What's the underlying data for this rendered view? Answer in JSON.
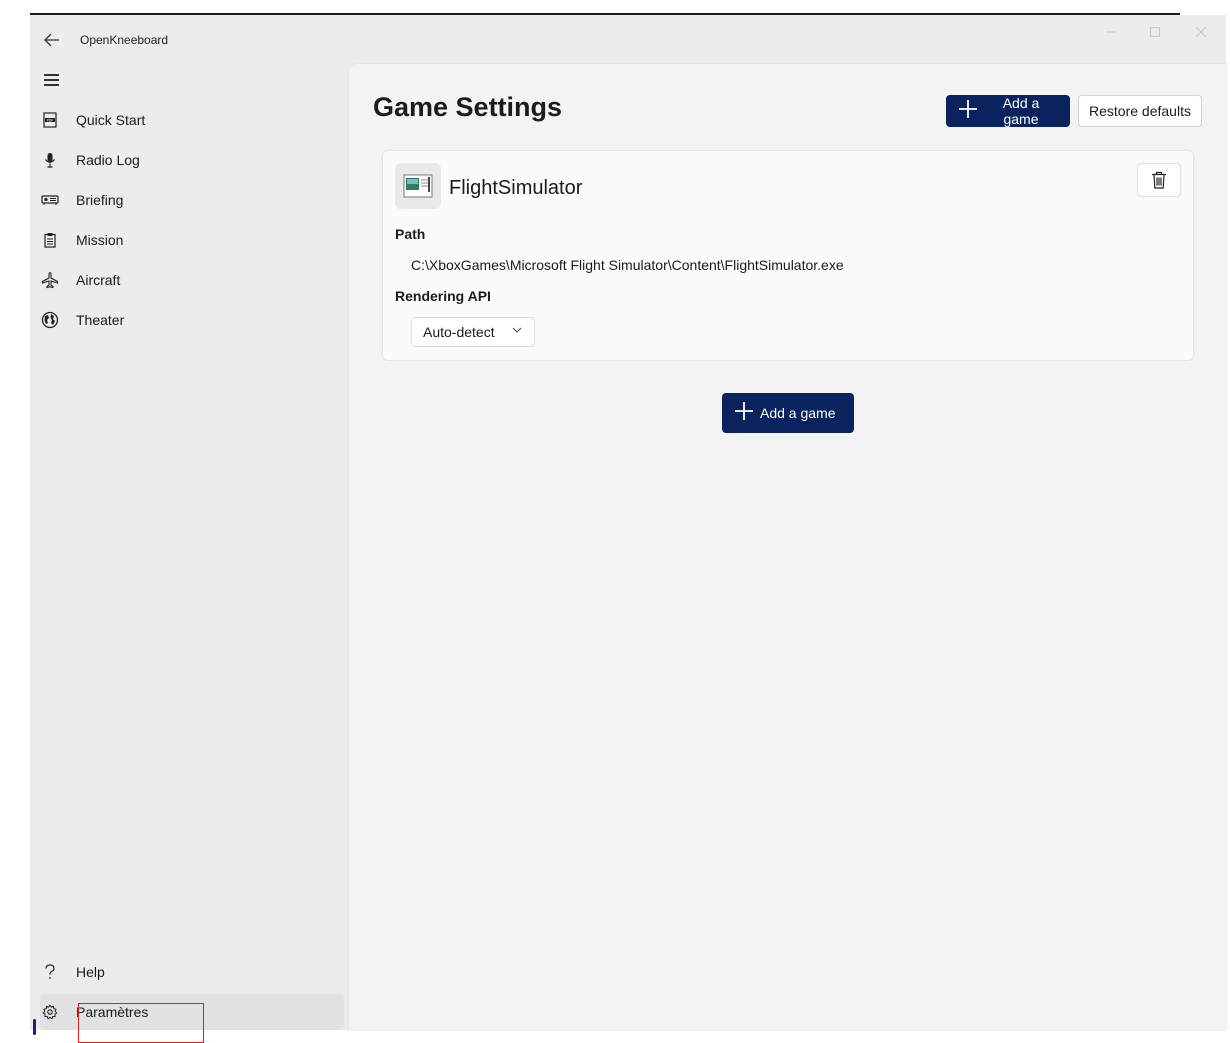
{
  "window": {
    "app_title": "OpenKneeboard"
  },
  "sidebar": {
    "items": [
      {
        "label": "Quick Start",
        "icon": "pdf-document-icon"
      },
      {
        "label": "Radio Log",
        "icon": "microphone-icon"
      },
      {
        "label": "Briefing",
        "icon": "projector-icon"
      },
      {
        "label": "Mission",
        "icon": "clipboard-icon"
      },
      {
        "label": "Aircraft",
        "icon": "airplane-icon"
      },
      {
        "label": "Theater",
        "icon": "globe-icon"
      }
    ],
    "footer": [
      {
        "label": "Help",
        "icon": "question-icon"
      },
      {
        "label": "Paramètres",
        "icon": "gear-icon",
        "selected": true
      }
    ]
  },
  "main": {
    "title": "Game Settings",
    "add_game_label": "Add a game",
    "restore_label": "Restore defaults",
    "games": [
      {
        "name": "FlightSimulator",
        "path_label": "Path",
        "path": "C:\\XboxGames\\Microsoft Flight Simulator\\Content\\FlightSimulator.exe",
        "api_label": "Rendering API",
        "api_value": "Auto-detect"
      }
    ],
    "bottom_add_label": "Add a game"
  },
  "colors": {
    "accent": "#0a235f",
    "highlight_box": "#e02020"
  }
}
